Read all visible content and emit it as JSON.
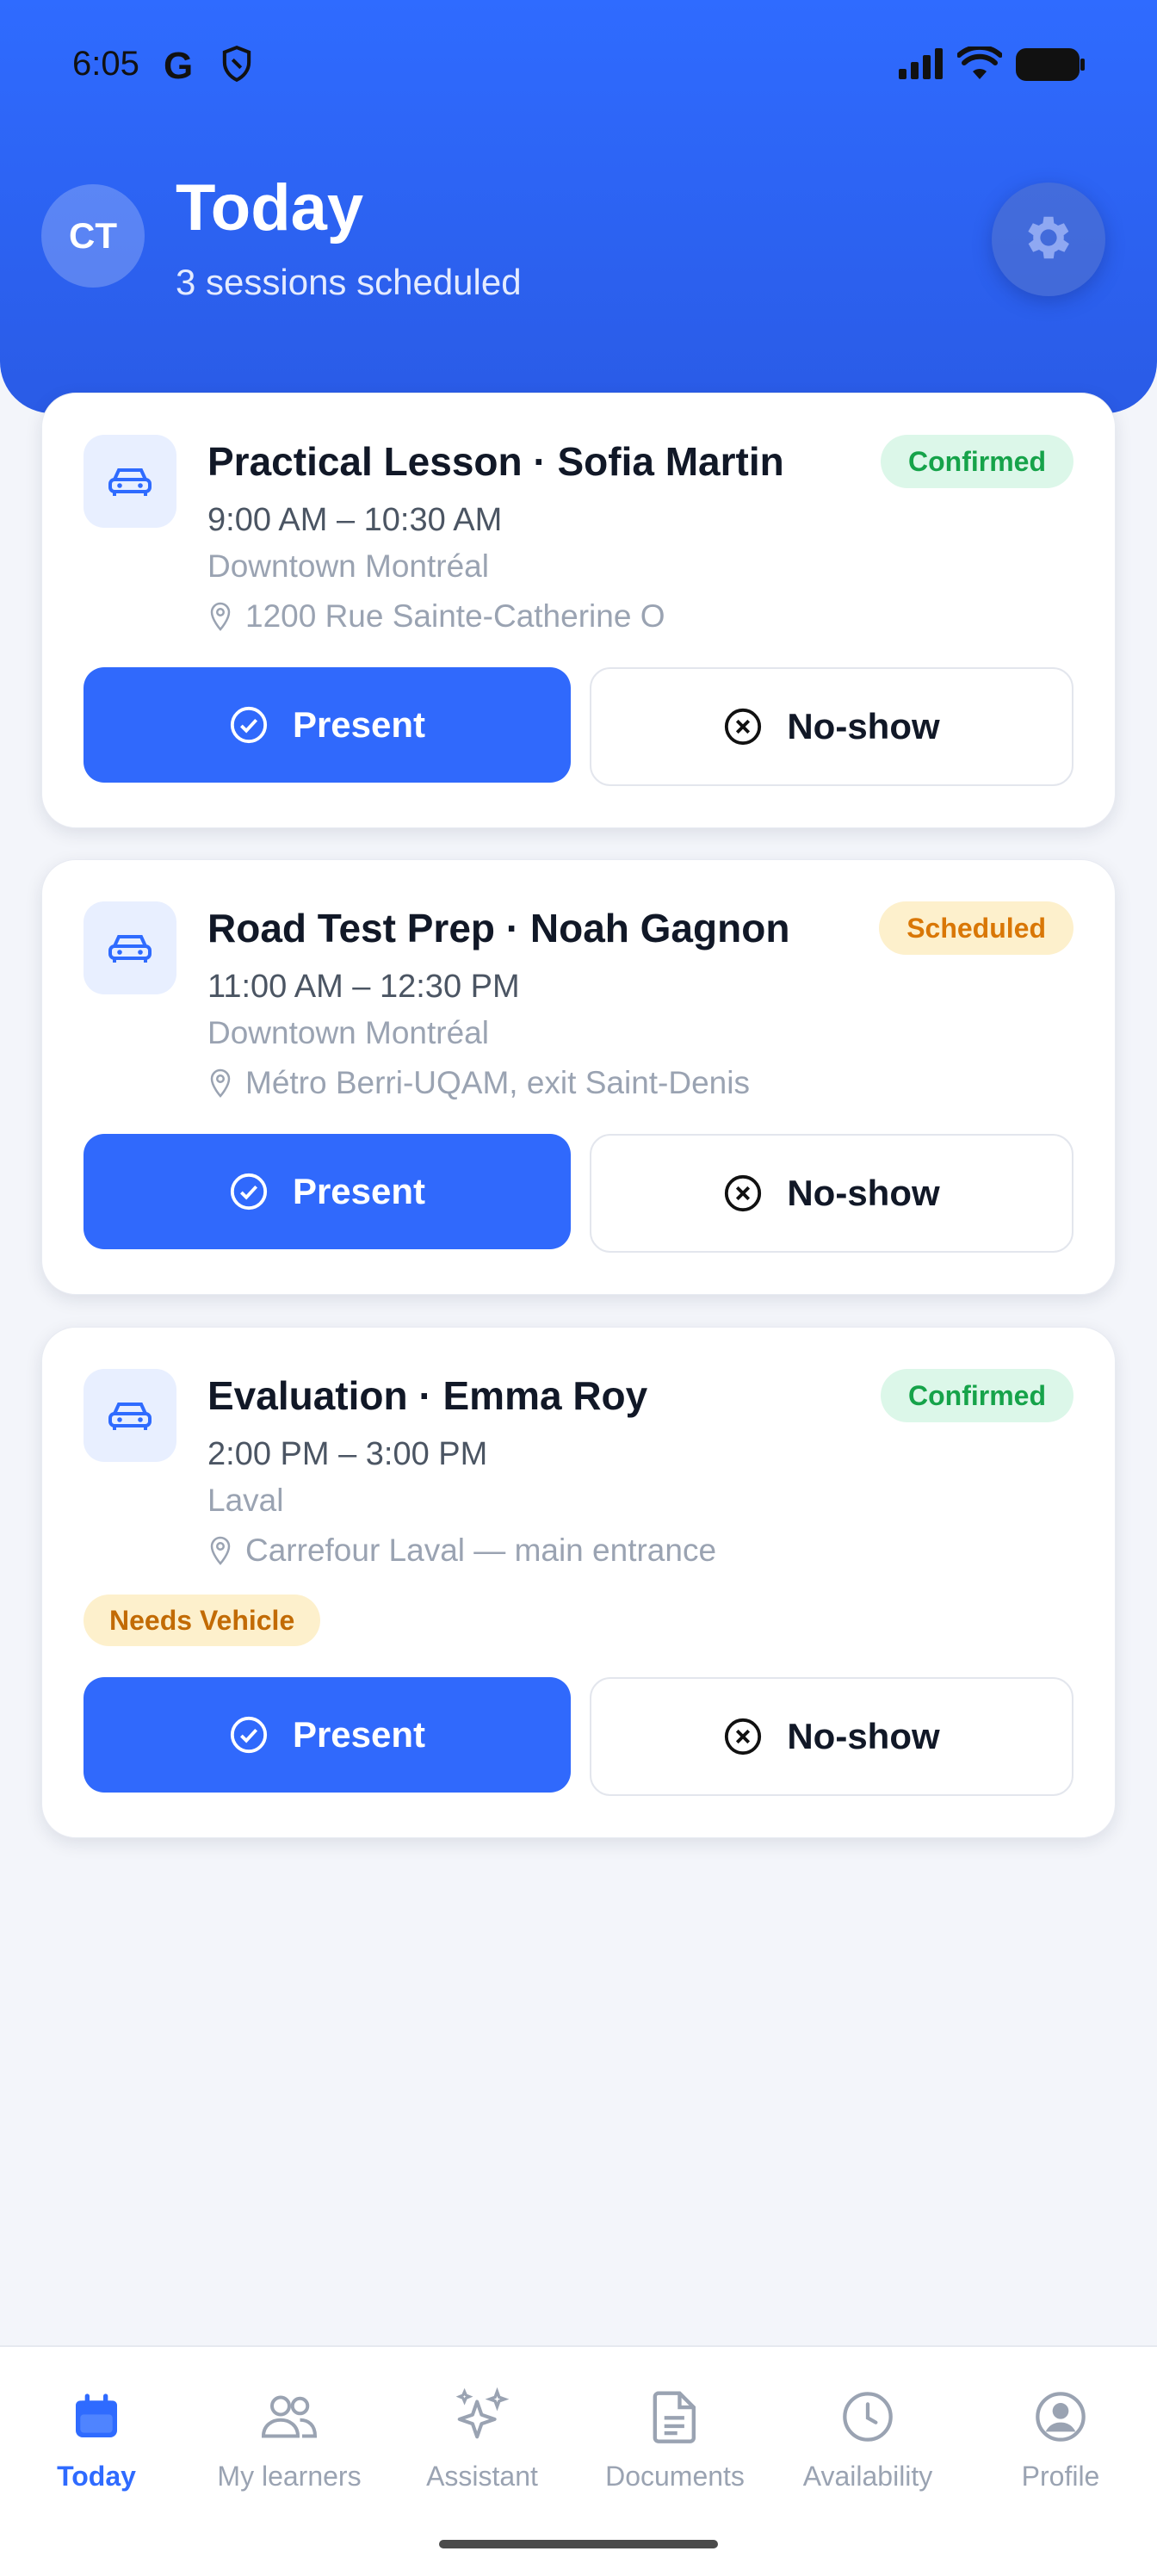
{
  "status_bar": {
    "time": "6:05",
    "g_label": "G"
  },
  "header": {
    "avatar_initials": "CT",
    "title": "Today",
    "subtitle": "3 sessions scheduled"
  },
  "sessions": [
    {
      "title": "Practical Lesson · Sofia Martin",
      "time": "9:00 AM – 10:30 AM",
      "area": "Downtown Montréal",
      "address": "1200 Rue Sainte-Catherine O",
      "status": "Confirmed",
      "tag": null,
      "present_label": "Present",
      "noshow_label": "No-show"
    },
    {
      "title": "Road Test Prep · Noah Gagnon",
      "time": "11:00 AM – 12:30 PM",
      "area": "Downtown Montréal",
      "address": "Métro Berri-UQAM, exit Saint-Denis",
      "status": "Scheduled",
      "tag": null,
      "present_label": "Present",
      "noshow_label": "No-show"
    },
    {
      "title": "Evaluation · Emma Roy",
      "time": "2:00 PM – 3:00 PM",
      "area": "Laval",
      "address": "Carrefour Laval — main entrance",
      "status": "Confirmed",
      "tag": "Needs Vehicle",
      "present_label": "Present",
      "noshow_label": "No-show"
    }
  ],
  "nav": {
    "items": [
      {
        "label": "Today",
        "icon": "calendar-icon",
        "active": true
      },
      {
        "label": "My learners",
        "icon": "users-icon",
        "active": false
      },
      {
        "label": "Assistant",
        "icon": "sparkles-icon",
        "active": false
      },
      {
        "label": "Documents",
        "icon": "document-icon",
        "active": false
      },
      {
        "label": "Availability",
        "icon": "clock-icon",
        "active": false
      },
      {
        "label": "Profile",
        "icon": "user-circle-icon",
        "active": false
      }
    ]
  },
  "colors": {
    "accent": "#2f6bff",
    "confirmed_bg": "#dcf7e9",
    "confirmed_text": "#16a34a",
    "scheduled_bg": "#fdf0cc",
    "scheduled_text": "#d97706"
  }
}
